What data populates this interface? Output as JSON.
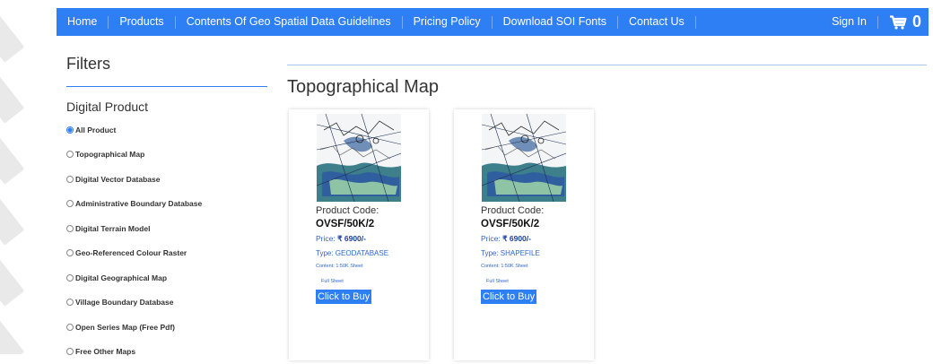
{
  "nav": {
    "items": [
      "Home",
      "Products",
      "Contents Of Geo Spatial Data Guidelines",
      "Pricing Policy",
      "Download SOI Fonts",
      "Contact Us"
    ],
    "sign_in": "Sign In",
    "cart_count": "0",
    "cart_icon": "shopping-cart-icon"
  },
  "sidebar": {
    "title": "Filters",
    "section": "Digital Product",
    "options": [
      "All Product",
      "Topographical Map",
      "Digital Vector Database",
      "Administrative Boundary Database",
      "Digital Terrain Model",
      "Geo-Referenced Colour Raster",
      "Digital Geographical Map",
      "Village Boundary Database",
      "Open Series Map (Free Pdf)",
      "Free Other Maps"
    ],
    "selected": "All Product"
  },
  "main": {
    "title": "Topographical Map",
    "products": [
      {
        "code_label": "Product Code:",
        "code": "OVSF/50K/2",
        "price_label": "Price:",
        "price": "₹ 6900/-",
        "type": "Type: GEODATABASE",
        "content": "Content: 1:50K Sheet",
        "sheet": "Full Sheet",
        "buy_label": "Click to Buy"
      },
      {
        "code_label": "Product Code:",
        "code": "OVSF/50K/2",
        "price_label": "Price:",
        "price": "₹ 6900/-",
        "type": "Type: SHAPEFILE",
        "content": "Content: 1:50K Sheet",
        "sheet": "Full Sheet",
        "buy_label": "Click to Buy"
      }
    ]
  },
  "colors": {
    "navbar": "#2e7ef4",
    "accent": "#2e66c9",
    "button": "#2e7ef4"
  }
}
